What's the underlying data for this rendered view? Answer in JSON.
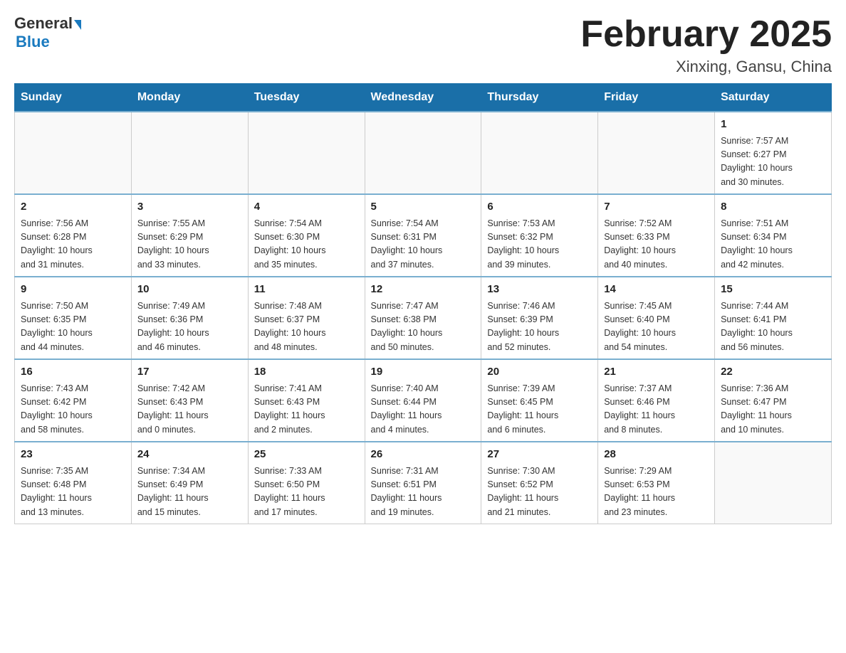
{
  "header": {
    "logo_general": "General",
    "logo_blue": "Blue",
    "title": "February 2025",
    "subtitle": "Xinxing, Gansu, China"
  },
  "days_of_week": [
    "Sunday",
    "Monday",
    "Tuesday",
    "Wednesday",
    "Thursday",
    "Friday",
    "Saturday"
  ],
  "weeks": [
    {
      "days": [
        {
          "num": "",
          "info": ""
        },
        {
          "num": "",
          "info": ""
        },
        {
          "num": "",
          "info": ""
        },
        {
          "num": "",
          "info": ""
        },
        {
          "num": "",
          "info": ""
        },
        {
          "num": "",
          "info": ""
        },
        {
          "num": "1",
          "info": "Sunrise: 7:57 AM\nSunset: 6:27 PM\nDaylight: 10 hours\nand 30 minutes."
        }
      ]
    },
    {
      "days": [
        {
          "num": "2",
          "info": "Sunrise: 7:56 AM\nSunset: 6:28 PM\nDaylight: 10 hours\nand 31 minutes."
        },
        {
          "num": "3",
          "info": "Sunrise: 7:55 AM\nSunset: 6:29 PM\nDaylight: 10 hours\nand 33 minutes."
        },
        {
          "num": "4",
          "info": "Sunrise: 7:54 AM\nSunset: 6:30 PM\nDaylight: 10 hours\nand 35 minutes."
        },
        {
          "num": "5",
          "info": "Sunrise: 7:54 AM\nSunset: 6:31 PM\nDaylight: 10 hours\nand 37 minutes."
        },
        {
          "num": "6",
          "info": "Sunrise: 7:53 AM\nSunset: 6:32 PM\nDaylight: 10 hours\nand 39 minutes."
        },
        {
          "num": "7",
          "info": "Sunrise: 7:52 AM\nSunset: 6:33 PM\nDaylight: 10 hours\nand 40 minutes."
        },
        {
          "num": "8",
          "info": "Sunrise: 7:51 AM\nSunset: 6:34 PM\nDaylight: 10 hours\nand 42 minutes."
        }
      ]
    },
    {
      "days": [
        {
          "num": "9",
          "info": "Sunrise: 7:50 AM\nSunset: 6:35 PM\nDaylight: 10 hours\nand 44 minutes."
        },
        {
          "num": "10",
          "info": "Sunrise: 7:49 AM\nSunset: 6:36 PM\nDaylight: 10 hours\nand 46 minutes."
        },
        {
          "num": "11",
          "info": "Sunrise: 7:48 AM\nSunset: 6:37 PM\nDaylight: 10 hours\nand 48 minutes."
        },
        {
          "num": "12",
          "info": "Sunrise: 7:47 AM\nSunset: 6:38 PM\nDaylight: 10 hours\nand 50 minutes."
        },
        {
          "num": "13",
          "info": "Sunrise: 7:46 AM\nSunset: 6:39 PM\nDaylight: 10 hours\nand 52 minutes."
        },
        {
          "num": "14",
          "info": "Sunrise: 7:45 AM\nSunset: 6:40 PM\nDaylight: 10 hours\nand 54 minutes."
        },
        {
          "num": "15",
          "info": "Sunrise: 7:44 AM\nSunset: 6:41 PM\nDaylight: 10 hours\nand 56 minutes."
        }
      ]
    },
    {
      "days": [
        {
          "num": "16",
          "info": "Sunrise: 7:43 AM\nSunset: 6:42 PM\nDaylight: 10 hours\nand 58 minutes."
        },
        {
          "num": "17",
          "info": "Sunrise: 7:42 AM\nSunset: 6:43 PM\nDaylight: 11 hours\nand 0 minutes."
        },
        {
          "num": "18",
          "info": "Sunrise: 7:41 AM\nSunset: 6:43 PM\nDaylight: 11 hours\nand 2 minutes."
        },
        {
          "num": "19",
          "info": "Sunrise: 7:40 AM\nSunset: 6:44 PM\nDaylight: 11 hours\nand 4 minutes."
        },
        {
          "num": "20",
          "info": "Sunrise: 7:39 AM\nSunset: 6:45 PM\nDaylight: 11 hours\nand 6 minutes."
        },
        {
          "num": "21",
          "info": "Sunrise: 7:37 AM\nSunset: 6:46 PM\nDaylight: 11 hours\nand 8 minutes."
        },
        {
          "num": "22",
          "info": "Sunrise: 7:36 AM\nSunset: 6:47 PM\nDaylight: 11 hours\nand 10 minutes."
        }
      ]
    },
    {
      "days": [
        {
          "num": "23",
          "info": "Sunrise: 7:35 AM\nSunset: 6:48 PM\nDaylight: 11 hours\nand 13 minutes."
        },
        {
          "num": "24",
          "info": "Sunrise: 7:34 AM\nSunset: 6:49 PM\nDaylight: 11 hours\nand 15 minutes."
        },
        {
          "num": "25",
          "info": "Sunrise: 7:33 AM\nSunset: 6:50 PM\nDaylight: 11 hours\nand 17 minutes."
        },
        {
          "num": "26",
          "info": "Sunrise: 7:31 AM\nSunset: 6:51 PM\nDaylight: 11 hours\nand 19 minutes."
        },
        {
          "num": "27",
          "info": "Sunrise: 7:30 AM\nSunset: 6:52 PM\nDaylight: 11 hours\nand 21 minutes."
        },
        {
          "num": "28",
          "info": "Sunrise: 7:29 AM\nSunset: 6:53 PM\nDaylight: 11 hours\nand 23 minutes."
        },
        {
          "num": "",
          "info": ""
        }
      ]
    }
  ]
}
